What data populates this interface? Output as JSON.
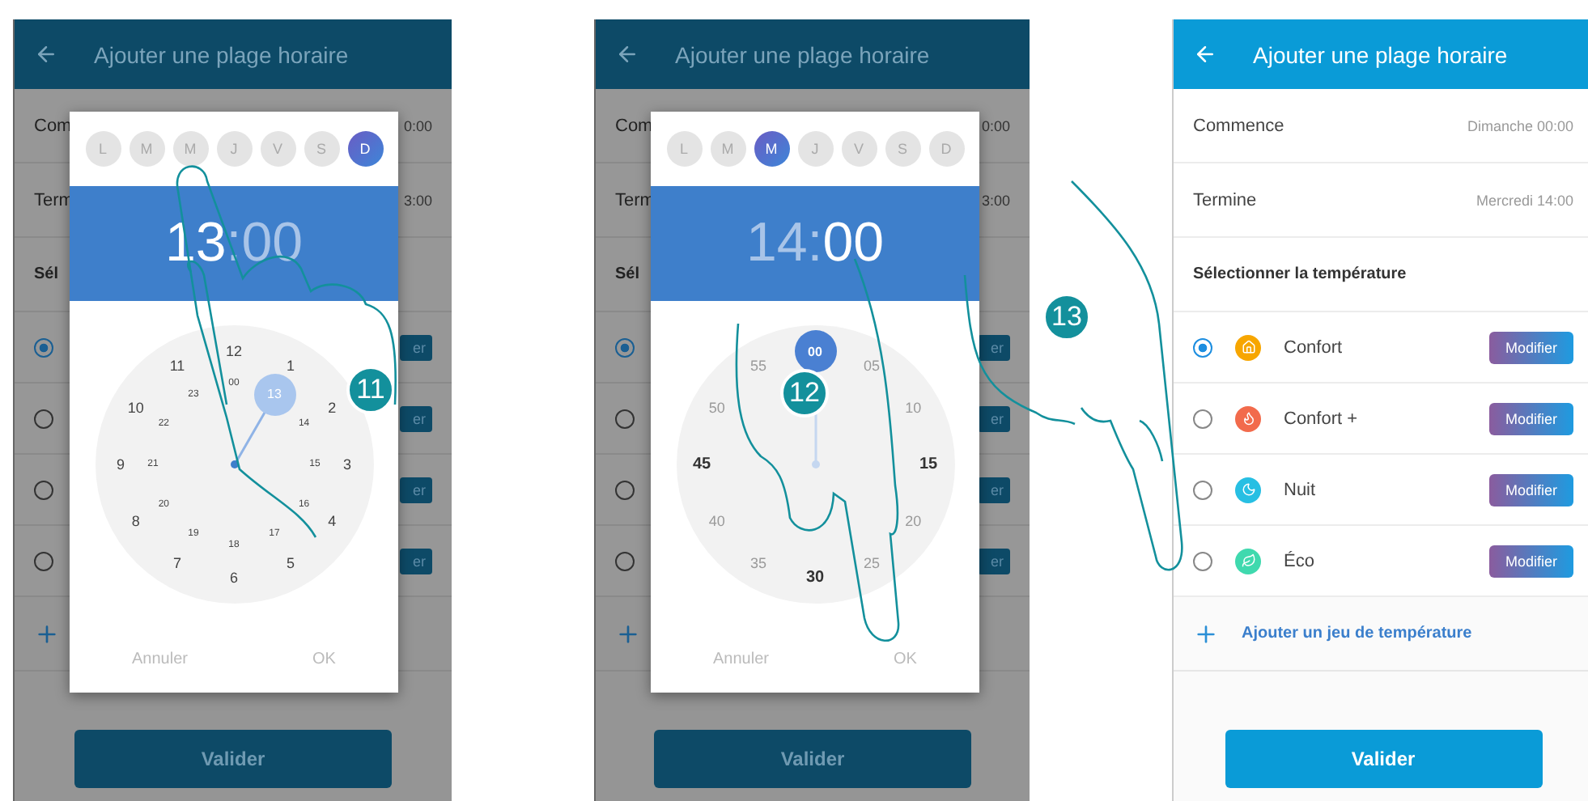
{
  "screens": [
    {
      "kind": "picker",
      "step": "11",
      "header": {
        "title": "Ajouter une plage horaire"
      },
      "background": {
        "rows": [
          {
            "label": "Com",
            "value": "0:00"
          },
          {
            "label": "Term",
            "value": "3:00"
          }
        ],
        "section": "Sél",
        "options": [
          {
            "selected": true,
            "button": "er"
          },
          {
            "selected": false,
            "button": "er"
          },
          {
            "selected": false,
            "button": "er"
          },
          {
            "selected": false,
            "button": "er"
          }
        ],
        "submit": "Valider"
      },
      "dialog": {
        "days": [
          {
            "label": "L",
            "selected": false
          },
          {
            "label": "M",
            "selected": false
          },
          {
            "label": "M",
            "selected": false
          },
          {
            "label": "J",
            "selected": false
          },
          {
            "label": "V",
            "selected": false
          },
          {
            "label": "S",
            "selected": false
          },
          {
            "label": "D",
            "selected": true
          }
        ],
        "time": {
          "hour": {
            "text": "13",
            "selected": true
          },
          "separator": ":",
          "minutes": {
            "text": "00",
            "selected": false
          }
        },
        "dial": {
          "kind": "hours",
          "outer": [
            {
              "label": "12",
              "selected": false
            },
            {
              "label": "1",
              "selected": false
            },
            {
              "label": "2",
              "selected": false
            },
            {
              "label": "3",
              "selected": false
            },
            {
              "label": "4",
              "selected": false
            },
            {
              "label": "5",
              "selected": false
            },
            {
              "label": "6",
              "selected": false
            },
            {
              "label": "7",
              "selected": false
            },
            {
              "label": "8",
              "selected": false
            },
            {
              "label": "9",
              "selected": false
            },
            {
              "label": "10",
              "selected": false
            },
            {
              "label": "11",
              "selected": false
            }
          ],
          "inner": [
            {
              "label": "00",
              "selected": false
            },
            {
              "label": "13",
              "selected": true
            },
            {
              "label": "14",
              "selected": false
            },
            {
              "label": "15",
              "selected": false
            },
            {
              "label": "16",
              "selected": false
            },
            {
              "label": "17",
              "selected": false
            },
            {
              "label": "18",
              "selected": false
            },
            {
              "label": "19",
              "selected": false
            },
            {
              "label": "20",
              "selected": false
            },
            {
              "label": "21",
              "selected": false
            },
            {
              "label": "22",
              "selected": false
            },
            {
              "label": "23",
              "selected": false
            }
          ]
        },
        "actions": [
          "Annuler",
          "OK"
        ]
      }
    },
    {
      "kind": "picker",
      "step": "12",
      "header": {
        "title": "Ajouter une plage horaire"
      },
      "background": {
        "rows": [
          {
            "label": "Com",
            "value": "0:00"
          },
          {
            "label": "Term",
            "value": "3:00"
          }
        ],
        "section": "Sél",
        "options": [
          {
            "selected": true,
            "button": "er"
          },
          {
            "selected": false,
            "button": "er"
          },
          {
            "selected": false,
            "button": "er"
          },
          {
            "selected": false,
            "button": "er"
          }
        ],
        "submit": "Valider"
      },
      "dialog": {
        "days": [
          {
            "label": "L",
            "selected": false
          },
          {
            "label": "M",
            "selected": false
          },
          {
            "label": "M",
            "selected": true
          },
          {
            "label": "J",
            "selected": false
          },
          {
            "label": "V",
            "selected": false
          },
          {
            "label": "S",
            "selected": false
          },
          {
            "label": "D",
            "selected": false
          }
        ],
        "time": {
          "hour": {
            "text": "14",
            "selected": false
          },
          "separator": ":",
          "minutes": {
            "text": "00",
            "selected": true
          }
        },
        "dial": {
          "kind": "minutes",
          "outer": [
            {
              "label": "00",
              "selected": true,
              "major": true
            },
            {
              "label": "05",
              "selected": false,
              "major": false
            },
            {
              "label": "10",
              "selected": false,
              "major": false
            },
            {
              "label": "15",
              "selected": false,
              "major": true
            },
            {
              "label": "20",
              "selected": false,
              "major": false
            },
            {
              "label": "25",
              "selected": false,
              "major": false
            },
            {
              "label": "30",
              "selected": false,
              "major": true
            },
            {
              "label": "35",
              "selected": false,
              "major": false
            },
            {
              "label": "40",
              "selected": false,
              "major": false
            },
            {
              "label": "45",
              "selected": false,
              "major": true
            },
            {
              "label": "50",
              "selected": false,
              "major": false
            },
            {
              "label": "55",
              "selected": false,
              "major": false
            }
          ]
        },
        "actions": [
          "Annuler",
          "OK"
        ]
      }
    },
    {
      "kind": "form",
      "step": "13",
      "header": {
        "title": "Ajouter une plage horaire"
      },
      "rows": [
        {
          "label": "Commence",
          "value": "Dimanche 00:00"
        },
        {
          "label": "Termine",
          "value": "Mercredi 14:00"
        }
      ],
      "section": "Sélectionner la température",
      "options": [
        {
          "kind": "comfort",
          "name": "Confort",
          "color": "#f7a600",
          "selected": true,
          "button": "Modifier"
        },
        {
          "kind": "comfort_plus",
          "name": "Confort +",
          "color": "#f26b4c",
          "selected": false,
          "button": "Modifier"
        },
        {
          "kind": "night",
          "name": "Nuit",
          "color": "#27bfe3",
          "selected": false,
          "button": "Modifier"
        },
        {
          "kind": "eco",
          "name": "Éco",
          "color": "#3fd9ae",
          "selected": false,
          "button": "Modifier"
        }
      ],
      "add": "Ajouter un jeu de température",
      "submit": "Valider"
    }
  ]
}
